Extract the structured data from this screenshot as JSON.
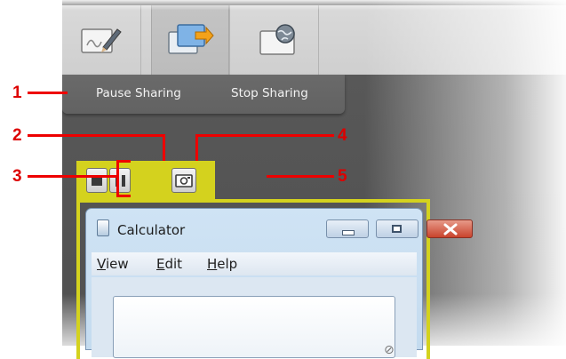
{
  "toolbar": {
    "buttons": [
      {
        "icon": "annotate-icon",
        "active": false
      },
      {
        "icon": "share-screen-icon",
        "active": true
      },
      {
        "icon": "web-share-icon",
        "active": false
      }
    ]
  },
  "share_menu": {
    "pause_label": "Pause Sharing",
    "stop_label": "Stop Sharing"
  },
  "sharing_controls": {
    "stop_icon": "stop-icon",
    "pause_icon": "pause-icon",
    "snapshot_icon": "snapshot-icon",
    "highlight_color": "#d4d21e"
  },
  "calculator": {
    "title": "Calculator",
    "menu": [
      "View",
      "Edit",
      "Help"
    ],
    "caption_buttons": [
      "minimize-icon",
      "maximize-icon",
      "close-icon"
    ]
  },
  "callouts": {
    "c1": "1",
    "c2": "2",
    "c3": "3",
    "c4": "4",
    "c5": "5",
    "color": "#dd0000"
  }
}
